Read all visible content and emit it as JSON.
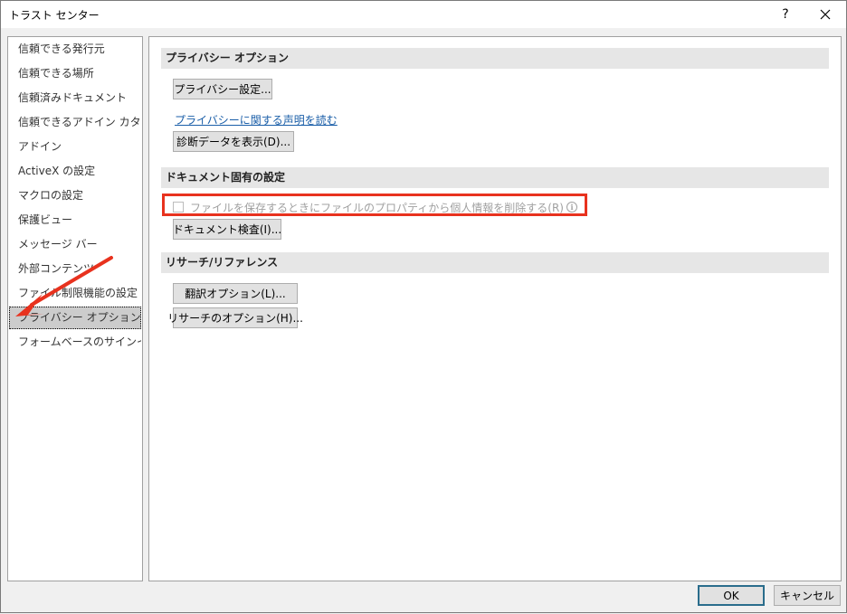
{
  "window": {
    "title": "トラスト センター",
    "help_label": "?",
    "close_label": "✕"
  },
  "sidebar": {
    "items": [
      {
        "label": "信頼できる発行元"
      },
      {
        "label": "信頼できる場所"
      },
      {
        "label": "信頼済みドキュメント"
      },
      {
        "label": "信頼できるアドイン カタログ"
      },
      {
        "label": "アドイン"
      },
      {
        "label": "ActiveX の設定"
      },
      {
        "label": "マクロの設定"
      },
      {
        "label": "保護ビュー"
      },
      {
        "label": "メッセージ バー"
      },
      {
        "label": "外部コンテンツ"
      },
      {
        "label": "ファイル制限機能の設定"
      },
      {
        "label": "プライバシー オプション",
        "selected": true
      },
      {
        "label": "フォームベースのサインイン"
      }
    ]
  },
  "main": {
    "privacy": {
      "header": "プライバシー オプション",
      "settings_button": "プライバシー設定...",
      "statement_link": "プライバシーに関する声明を読む",
      "diagnostics_button": "診断データを表示(D)..."
    },
    "document": {
      "header": "ドキュメント固有の設定",
      "remove_info_checkbox": "ファイルを保存するときにファイルのプロパティから個人情報を削除する(R)",
      "remove_info_checked": false,
      "inspect_button": "ドキュメント検査(I)..."
    },
    "research": {
      "header": "リサーチ/リファレンス",
      "translation_button": "翻訳オプション(L)...",
      "research_button": "リサーチのオプション(H)..."
    }
  },
  "footer": {
    "ok_label": "OK",
    "cancel_label": "キャンセル"
  },
  "annotations": {
    "highlight_color": "#e8321e",
    "arrow_color": "#e8321e"
  }
}
